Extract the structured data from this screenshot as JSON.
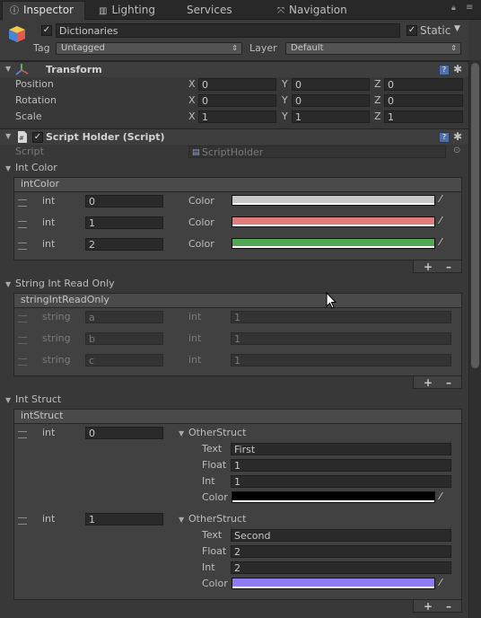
{
  "tabs": [
    {
      "label": "Inspector",
      "icon": "info-icon"
    },
    {
      "label": "Lighting",
      "icon": "lighting-icon"
    },
    {
      "label": "Services",
      "icon": ""
    },
    {
      "label": "Navigation",
      "icon": "navigation-icon"
    }
  ],
  "object": {
    "name": "Dictionaries",
    "active": true,
    "static_label": "Static",
    "static": true,
    "tag_label": "Tag",
    "tag_value": "Untagged",
    "layer_label": "Layer",
    "layer_value": "Default"
  },
  "transform": {
    "title": "Transform",
    "rows": [
      {
        "label": "Position",
        "x": "0",
        "y": "0",
        "z": "0"
      },
      {
        "label": "Rotation",
        "x": "0",
        "y": "0",
        "z": "0"
      },
      {
        "label": "Scale",
        "x": "1",
        "y": "1",
        "z": "1"
      }
    ],
    "axis": {
      "x": "X",
      "y": "Y",
      "z": "Z"
    }
  },
  "script_holder": {
    "title": "Script Holder (Script)",
    "script_label": "Script",
    "script_value": "ScriptHolder"
  },
  "int_color": {
    "section": "Int Color",
    "list_name": "intColor",
    "key_type": "int",
    "value_type": "Color",
    "rows": [
      {
        "key": "0",
        "color": "#c8c8c8"
      },
      {
        "key": "1",
        "color": "#e07c7c"
      },
      {
        "key": "2",
        "color": "#52a852"
      }
    ]
  },
  "string_int": {
    "section": "String Int Read Only",
    "list_name": "stringIntReadOnly",
    "key_type": "string",
    "value_type": "int",
    "rows": [
      {
        "key": "a",
        "value": "1"
      },
      {
        "key": "b",
        "value": "1"
      },
      {
        "key": "c",
        "value": "1"
      }
    ]
  },
  "int_struct": {
    "section": "Int Struct",
    "list_name": "intStruct",
    "key_type": "int",
    "struct_label": "OtherStruct",
    "field_labels": {
      "text": "Text",
      "float": "Float",
      "int": "Int",
      "color": "Color"
    },
    "rows": [
      {
        "key": "0",
        "text": "First",
        "float": "1",
        "int": "1",
        "color": "#000000"
      },
      {
        "key": "1",
        "text": "Second",
        "float": "2",
        "int": "2",
        "color": "#8f7cf2"
      }
    ]
  },
  "footer": {
    "add": "+",
    "remove": "–"
  }
}
